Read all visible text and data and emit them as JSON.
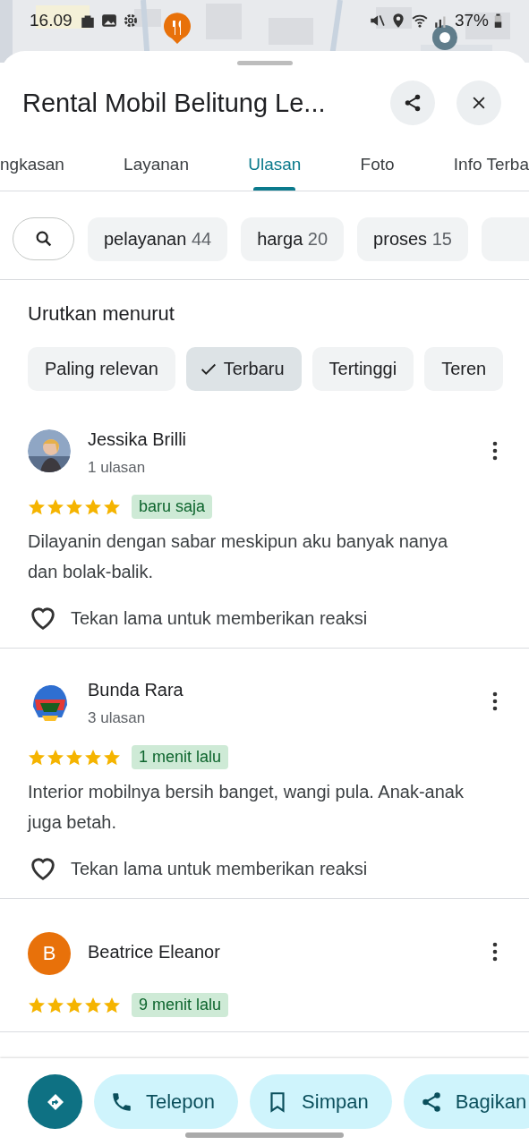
{
  "status_bar": {
    "time": "16.09",
    "battery": "37%"
  },
  "place": {
    "title": "Rental Mobil Belitung Le..."
  },
  "tabs": [
    {
      "label": "ngkasan",
      "selected": false
    },
    {
      "label": "Layanan",
      "selected": false
    },
    {
      "label": "Ulasan",
      "selected": true
    },
    {
      "label": "Foto",
      "selected": false
    },
    {
      "label": "Info Terba",
      "selected": false
    }
  ],
  "topic_chips": [
    {
      "label": "pelayanan",
      "count": "44"
    },
    {
      "label": "harga",
      "count": "20"
    },
    {
      "label": "proses",
      "count": "15"
    }
  ],
  "sort": {
    "heading": "Urutkan menurut",
    "options": [
      {
        "label": "Paling relevan",
        "selected": false
      },
      {
        "label": "Terbaru",
        "selected": true
      },
      {
        "label": "Tertinggi",
        "selected": false
      },
      {
        "label": "Teren",
        "selected": false
      }
    ]
  },
  "reviews": [
    {
      "name": "Jessika Brilli",
      "count": "1 ulasan",
      "stars": 5,
      "time": "baru saja",
      "text": "Dilayanin dengan sabar meskipun aku banyak nanya dan bolak-balik.",
      "reaction": "Tekan lama untuk memberikan reaksi"
    },
    {
      "name": "Bunda Rara",
      "count": "3 ulasan",
      "stars": 5,
      "time": "1 menit lalu",
      "text": "Interior mobilnya bersih banget, wangi pula. Anak-anak juga betah.",
      "reaction": "Tekan lama untuk memberikan reaksi"
    },
    {
      "avatar": {
        "kind": "letter",
        "letter": "B",
        "color": "#e8710a"
      },
      "name": "Beatrice Eleanor",
      "stars": 5,
      "time": "9 menit lalu"
    }
  ],
  "actions": [
    {
      "kind": "directions"
    },
    {
      "kind": "call",
      "label": "Telepon"
    },
    {
      "kind": "save",
      "label": "Simpan"
    },
    {
      "kind": "share",
      "label": "Bagikan"
    }
  ]
}
